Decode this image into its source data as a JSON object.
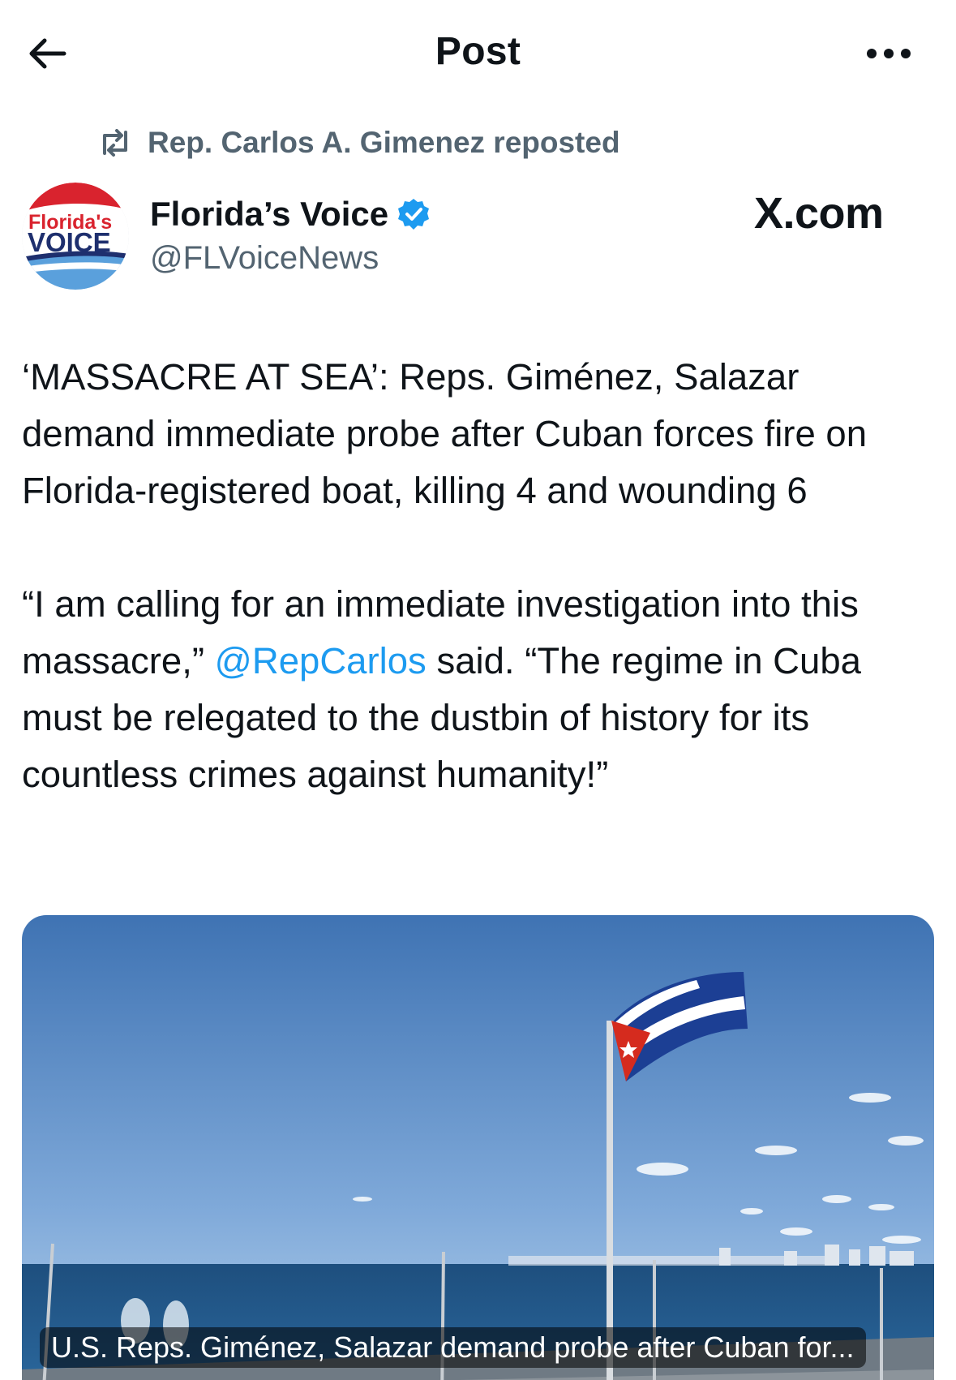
{
  "header": {
    "title": "Post"
  },
  "repost": {
    "text": "Rep. Carlos A. Gimenez reposted"
  },
  "author": {
    "name": "Florida’s Voice",
    "handle": "@FLVoiceNews",
    "verified": true,
    "avatar_logo_text_top": "Florida's",
    "avatar_logo_text_bottom": "VOICE"
  },
  "source_mark": "X.com",
  "post": {
    "paragraph1": "‘MASSACRE AT SEA’: Reps. Giménez, Salazar demand immediate probe after Cuban forces fire on Florida-registered boat, killing 4 and wounding 6",
    "paragraph2_before": "“I am calling for an immediate investigation into this massacre,” ",
    "paragraph2_mention": "@RepCarlos",
    "paragraph2_after": " said. “The regime in Cuba must be relegated to the dustbin of history for its countless crimes against humanity!”"
  },
  "card": {
    "caption": "U.S. Reps. Giménez, Salazar demand probe after Cuban for..."
  },
  "colors": {
    "text": "#0f1419",
    "secondary": "#536471",
    "accent": "#1d9bf0",
    "sky_top": "#3f73b3",
    "sky_bottom": "#a9cbea",
    "sea": "#1e4f7e"
  },
  "icons": {
    "back": "arrow-left-icon",
    "more": "more-horizontal-icon",
    "repost": "repost-icon",
    "verified": "verified-badge-icon"
  }
}
